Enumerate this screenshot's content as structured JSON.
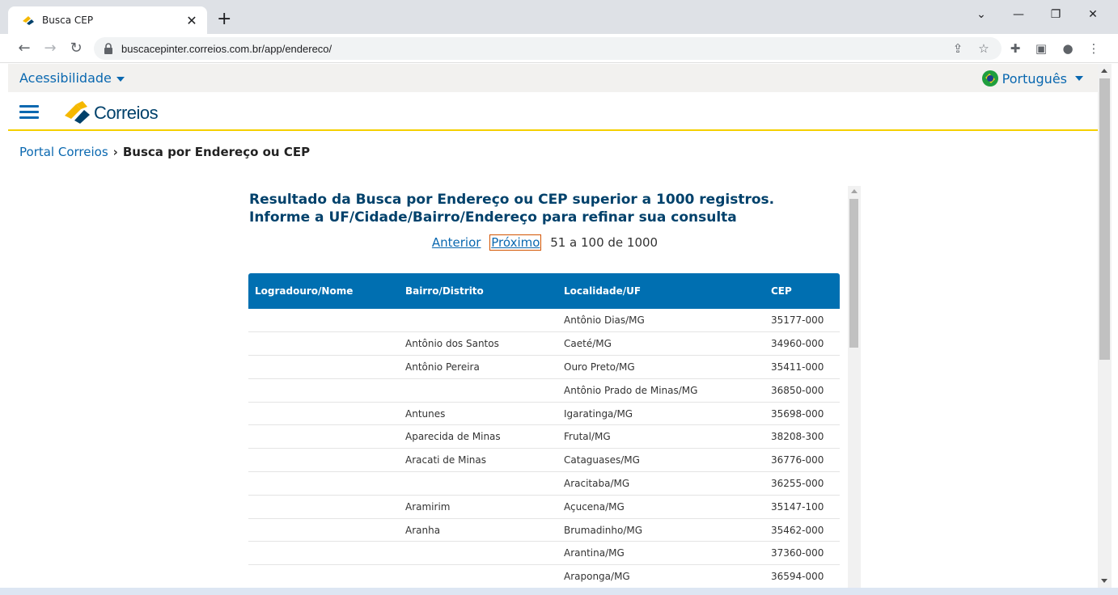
{
  "browser": {
    "tab_title": "Busca CEP",
    "tab_close": "✕",
    "new_tab": "+",
    "url": "buscacepinter.correios.com.br/app/endereco/",
    "window_controls": {
      "minimize": "—",
      "restore": "❐",
      "close": "✕",
      "tabs_menu": "⌄"
    },
    "nav": {
      "back": "←",
      "forward": "→",
      "reload": "↻"
    },
    "toolbar_icons": {
      "share": "⇪",
      "bookmark": "☆",
      "extensions": "✚",
      "sidepanel": "▣",
      "profile": "●",
      "menu": "⋮"
    }
  },
  "topbar": {
    "accessibility_label": "Acessibilidade",
    "language_label": "Português"
  },
  "header": {
    "logo_text": "Correios",
    "brand_colors": {
      "blue": "#00416b",
      "yellow": "#f5d000",
      "link": "#0a68b0"
    }
  },
  "breadcrumb": {
    "home": "Portal Correios",
    "separator": "›",
    "current": "Busca por Endereço ou CEP"
  },
  "result": {
    "title_line1": "Resultado da Busca por Endereço ou CEP superior a 1000 registros.",
    "title_line2": "Informe a UF/Cidade/Bairro/Endereço para refinar sua consulta"
  },
  "pager": {
    "prev_label": "Anterior",
    "next_label": "Próximo",
    "range_text": "51 a 100 de 1000"
  },
  "table": {
    "headers": [
      "Logradouro/Nome",
      "Bairro/Distrito",
      "Localidade/UF",
      "CEP"
    ],
    "rows": [
      [
        "",
        "",
        "Antônio Dias/MG",
        "35177-000"
      ],
      [
        "",
        "Antônio dos Santos",
        "Caeté/MG",
        "34960-000"
      ],
      [
        "",
        "Antônio Pereira",
        "Ouro Preto/MG",
        "35411-000"
      ],
      [
        "",
        "",
        "Antônio Prado de Minas/MG",
        "36850-000"
      ],
      [
        "",
        "Antunes",
        "Igaratinga/MG",
        "35698-000"
      ],
      [
        "",
        "Aparecida de Minas",
        "Frutal/MG",
        "38208-300"
      ],
      [
        "",
        "Aracati de Minas",
        "Cataguases/MG",
        "36776-000"
      ],
      [
        "",
        "",
        "Aracitaba/MG",
        "36255-000"
      ],
      [
        "",
        "Aramirim",
        "Açucena/MG",
        "35147-100"
      ],
      [
        "",
        "Aranha",
        "Brumadinho/MG",
        "35462-000"
      ],
      [
        "",
        "",
        "Arantina/MG",
        "37360-000"
      ],
      [
        "",
        "",
        "Araponga/MG",
        "36594-000"
      ]
    ]
  }
}
